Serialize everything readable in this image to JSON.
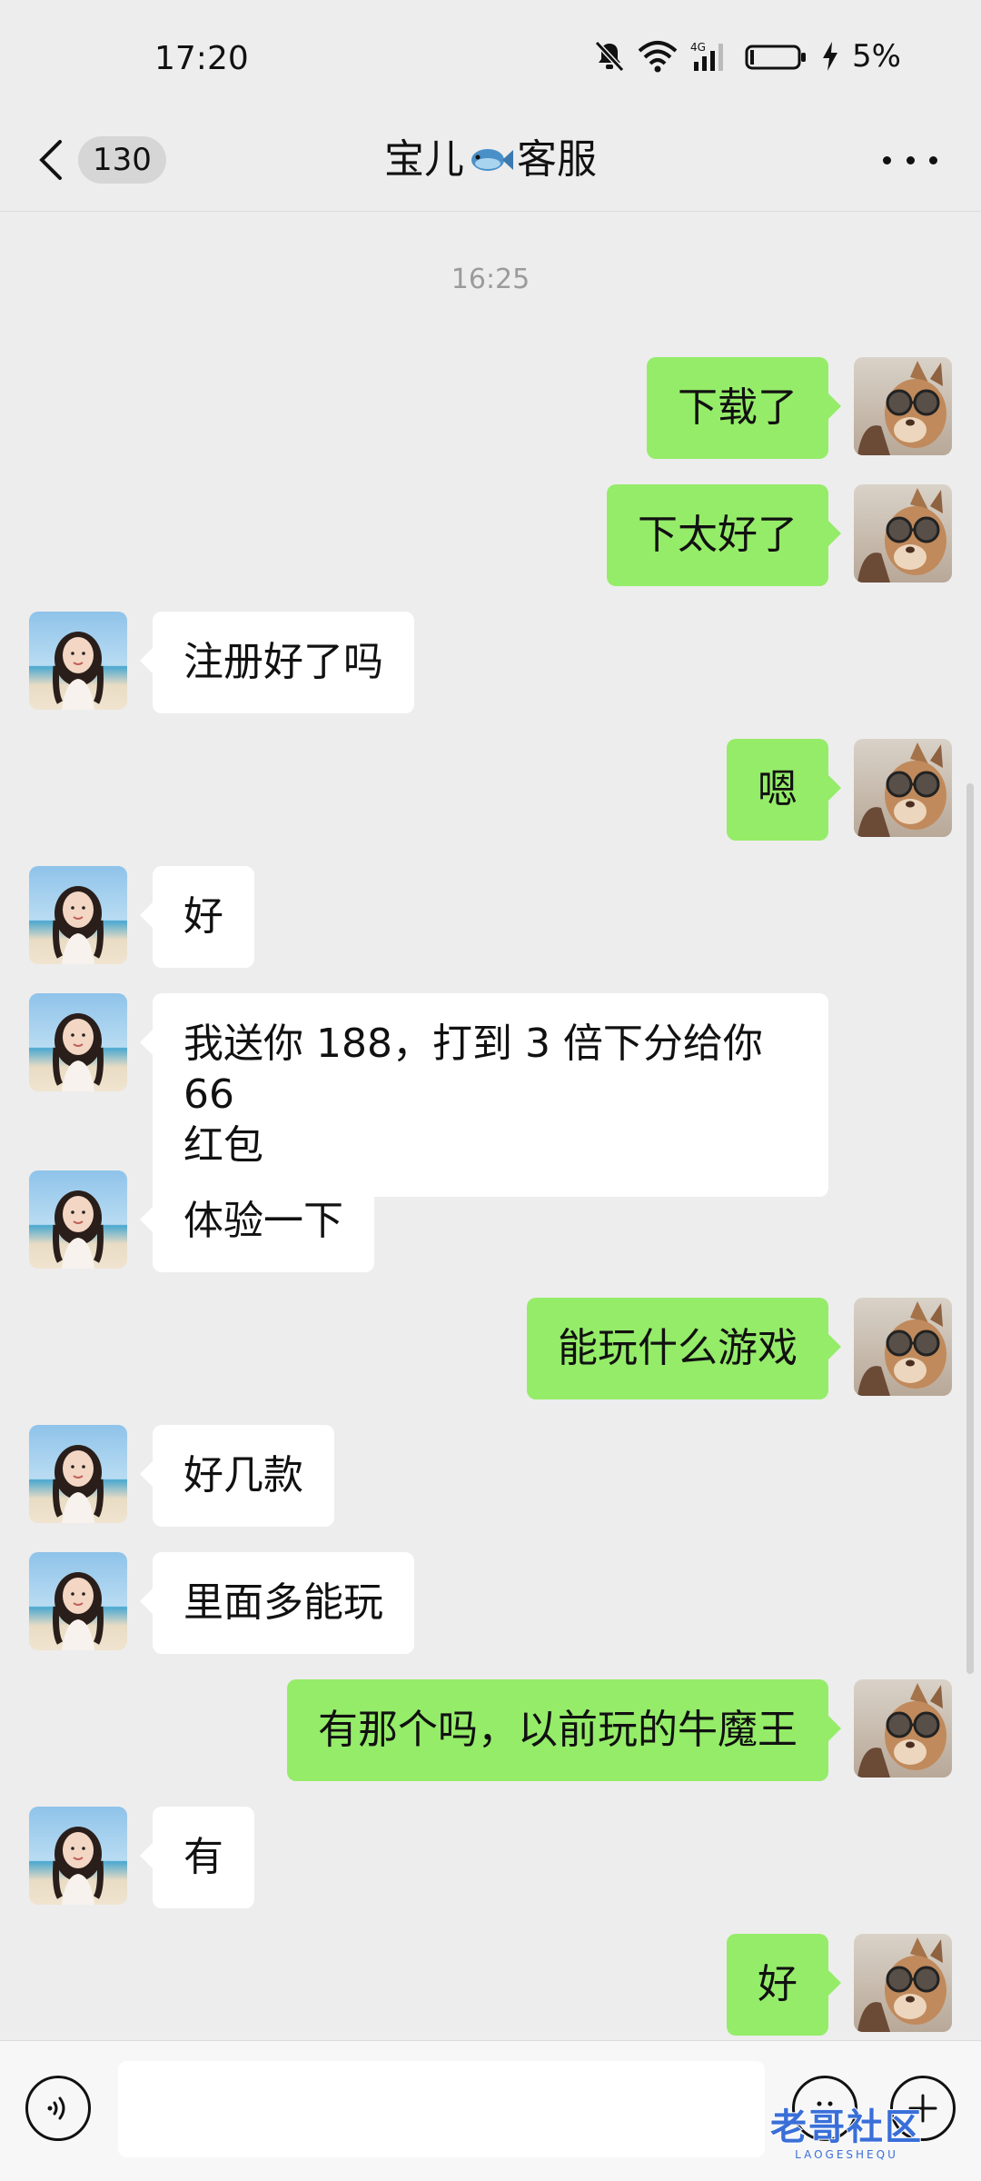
{
  "status_bar": {
    "time": "17:20",
    "battery": "5%",
    "network": "4G"
  },
  "header": {
    "back_count": "130",
    "title_part1": "宝儿",
    "title_part2": "客服"
  },
  "timestamp": "16:25",
  "messages": [
    {
      "side": "right",
      "text": "下载了"
    },
    {
      "side": "right",
      "text": "下太好了"
    },
    {
      "side": "left",
      "text": "注册好了吗"
    },
    {
      "side": "right",
      "text": "嗯"
    },
    {
      "side": "left",
      "text": "好"
    },
    {
      "side": "left",
      "text_line1": "我送你 188，打到 3 倍下分给你 66",
      "text_line2": "红包"
    },
    {
      "side": "left",
      "text": "体验一下"
    },
    {
      "side": "right",
      "text": "能玩什么游戏"
    },
    {
      "side": "left",
      "text": "好几款"
    },
    {
      "side": "left",
      "text": "里面多能玩"
    },
    {
      "side": "right",
      "text": "有那个吗，以前玩的牛魔王"
    },
    {
      "side": "left",
      "text": "有"
    },
    {
      "side": "right",
      "text": "好"
    }
  ],
  "input": {
    "value": "",
    "placeholder": ""
  },
  "watermark": {
    "main": "老哥社区",
    "sub": "LAOGESHEQU"
  },
  "colors": {
    "background": "#ededed",
    "sent_bubble": "#95ec69",
    "received_bubble": "#ffffff"
  }
}
